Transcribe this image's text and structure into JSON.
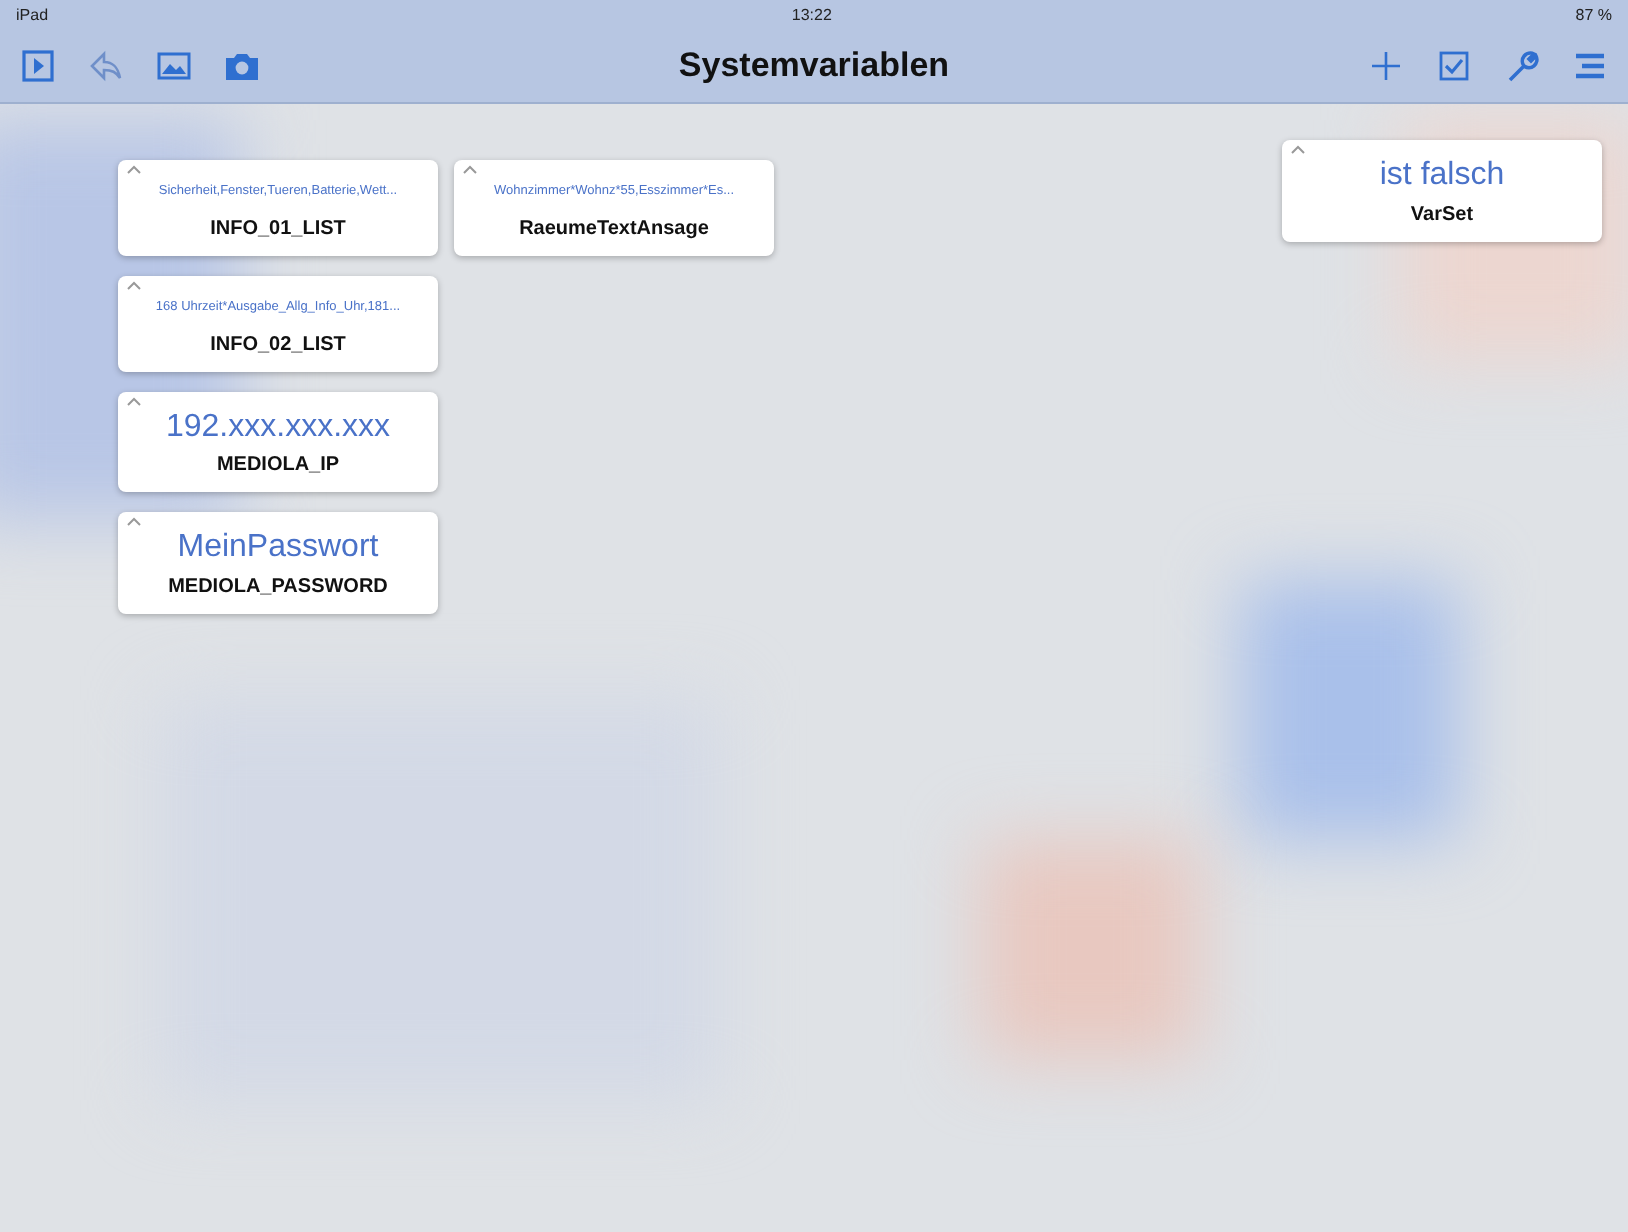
{
  "status_bar": {
    "device": "iPad",
    "time": "13:22",
    "battery": "87 %"
  },
  "nav_bar": {
    "title": "Systemvariablen"
  },
  "columns": [
    [
      {
        "kind": "list",
        "value": "Sicherheit,Fenster,Tueren,Batterie,Wett...",
        "name": "INFO_01_LIST"
      },
      {
        "kind": "list",
        "value": "168 Uhrzeit*Ausgabe_Allg_Info_Uhr,181...",
        "name": "INFO_02_LIST"
      },
      {
        "kind": "text",
        "value": "192.xxx.xxx.xxx",
        "name": "MEDIOLA_IP"
      },
      {
        "kind": "text",
        "value": "MeinPasswort",
        "name": "MEDIOLA_PASSWORD"
      }
    ],
    [
      {
        "kind": "list",
        "value": "Wohnzimmer*Wohnz*55,Esszimmer*Es...",
        "name": "RaeumeTextAnsage"
      }
    ]
  ],
  "right_column": [
    {
      "kind": "text",
      "value": "ist falsch",
      "name": "VarSet"
    }
  ]
}
